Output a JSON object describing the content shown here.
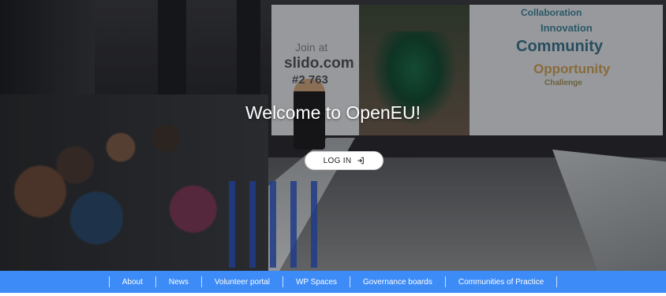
{
  "hero": {
    "headline": "Welcome to OpenEU!",
    "login_label": "LOG IN",
    "login_icon": "login-arrow-icon"
  },
  "slide": {
    "join": "Join at",
    "site": "slido.com",
    "code": "#2  763",
    "word_cloud": [
      "Collaboration",
      "Innovation",
      "Community",
      "Opportunity",
      "Challenge"
    ]
  },
  "nav": {
    "items": [
      "About",
      "News",
      "Volunteer portal",
      "WP Spaces",
      "Governance boards",
      "Communities of Practice"
    ]
  },
  "colors": {
    "nav_bar": "#3d8bf7",
    "login_bg": "#ffffff",
    "headline": "#ffffff"
  }
}
